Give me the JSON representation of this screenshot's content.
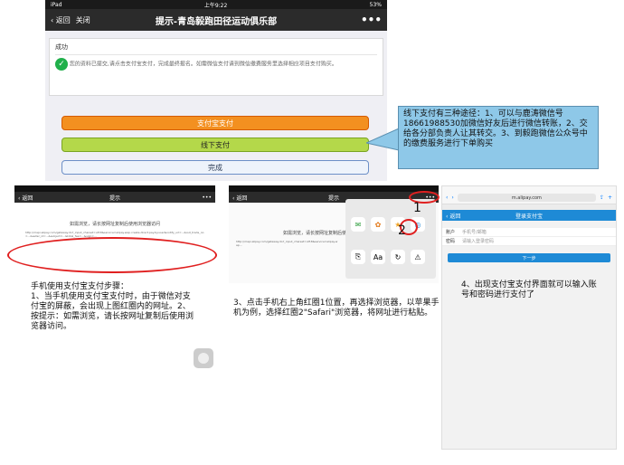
{
  "main": {
    "status_left": "iPad",
    "status_time": "上午9:22",
    "status_right": "53%",
    "back_label": "返回",
    "close_label": "关闭",
    "title": "提示-青岛毅跑田径运动俱乐部",
    "more": "•••",
    "card_status": "成功",
    "card_message": "您的资料已提交,请点击支付宝支付，完成最终报名。如需微信支付请到微信缴费服务里选择相应项目支付购买。",
    "btn_pay": "支付宝支付",
    "btn_offline": "线下支付",
    "btn_done": "完成"
  },
  "callout_text": "线下支付有三种途径：1、可以与鹿涛微信号18661988530加微信好友后进行微信转账，2、交给各分部负责人让其转交。3、到毅跑微信公众号中的缴费服务进行下单购买",
  "shot1": {
    "back": "返回",
    "title": "提示",
    "more": "•••",
    "tip": "如需浏览，请长按网址复制后使用浏览器访问",
    "url": "http://mapi.alipay.com/gateway.do?_input_charset=utf-8&service=alipay.wap.create.direct.pay.by.user&notify_url=...&out_trade_no=...&seller_id=...&subject=...&total_fee=...&sign=..."
  },
  "step1_text": "手机使用支付宝支付步骤：\n1、当手机使用支付宝支付时，由于微信对支付宝的屏蔽，会出现上图红圈内的网址。2、按提示：如需浏览，请长按网址复制后使用浏览器访问。",
  "shot2": {
    "back": "返回",
    "title": "提示",
    "more": "•••",
    "tip": "如需浏览，请长按网址复制后使用",
    "label1": "1",
    "label2": "2",
    "apps": [
      "发送给朋友",
      "分享到朋友圈",
      "收藏",
      "在Safari中打开"
    ],
    "actions": [
      "复制链接",
      "调整字体",
      "刷新",
      "投诉"
    ]
  },
  "step3_text": "3、点击手机右上角红圈1位置，再选择浏览器，以苹果手机为例，选择红圈2\"Safari\"浏览器，将网址进行粘贴。",
  "shot3": {
    "url_host": "m.alipay.com",
    "back": "返回",
    "title": "登录支付宝",
    "field_account": "账户",
    "field_account_ph": "手机号/邮箱",
    "field_password": "密码",
    "field_password_ph": "请输入登录密码",
    "next": "下一步"
  },
  "step4_text": "4、出现支付宝支付界面就可以输入账号和密码进行支付了"
}
